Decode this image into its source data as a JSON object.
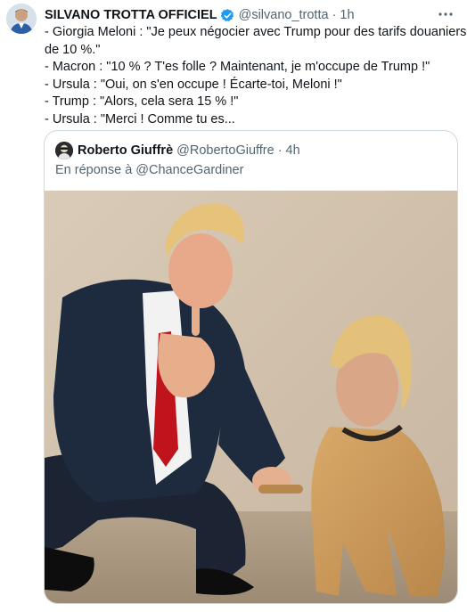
{
  "tweet": {
    "author_name": "SILVANO TROTTA OFFICIEL",
    "handle": "@silvano_trotta",
    "separator": "·",
    "time": "1h",
    "lines": [
      "- Giorgia Meloni : \"Je peux négocier avec Trump pour des tarifs douaniers",
      "de 10 %.\"",
      "- Macron : \"10 % ? T'es folle ? Maintenant, je m'occupe de Trump !\"",
      "- Ursula : \"Oui, on s'en occupe ! Écarte-toi, Meloni !\"",
      "- Trump : \"Alors, cela sera 15 % !\"",
      "- Ursula : \"Merci ! Comme tu es..."
    ],
    "verified_color": "#1d9bf0"
  },
  "quote": {
    "author_name": "Roberto Giuffrè",
    "handle": "@RobertoGiuffre",
    "separator": "·",
    "time": "4h",
    "reply_prefix": "En réponse à",
    "reply_mention": "@ChanceGardiner"
  },
  "icons": {
    "verified": "verified-badge-icon",
    "more": "more-options-icon"
  }
}
